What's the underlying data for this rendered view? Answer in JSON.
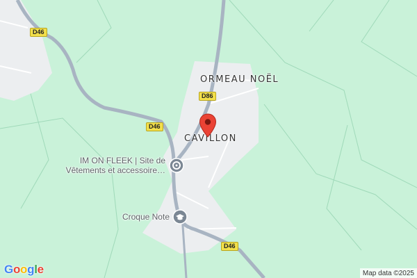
{
  "map": {
    "colors": {
      "land": "#c9f2d9",
      "built_area": "#eceef0",
      "road": "#a8b4c2",
      "minor_road": "#ffffff",
      "boundary": "#9fd9b9",
      "pin": "#ea4335",
      "poi": "#7b8794"
    },
    "road_labels": {
      "d46_top": "D46",
      "d46_mid": "D46",
      "d46_bottom": "D46",
      "d86": "D86"
    },
    "places": {
      "ormeau_noel": "ORMEAU NOËL",
      "cavillon": "CAVILLON"
    },
    "pois": [
      {
        "line1": "IM ON FLEEK | Site de",
        "line2": "Vêtements et accessoire…",
        "icon": "shopping-bag-icon"
      },
      {
        "line1": "Croque Note",
        "icon": "graduation-cap-icon"
      }
    ],
    "marker": {
      "icon": "location-pin-icon"
    },
    "google_logo": [
      "G",
      "o",
      "o",
      "g",
      "l",
      "e"
    ],
    "google_logo_colors": [
      "#4285F4",
      "#EA4335",
      "#FBBC05",
      "#4285F4",
      "#34A853",
      "#EA4335"
    ],
    "attribution": "Map data ©2025"
  }
}
